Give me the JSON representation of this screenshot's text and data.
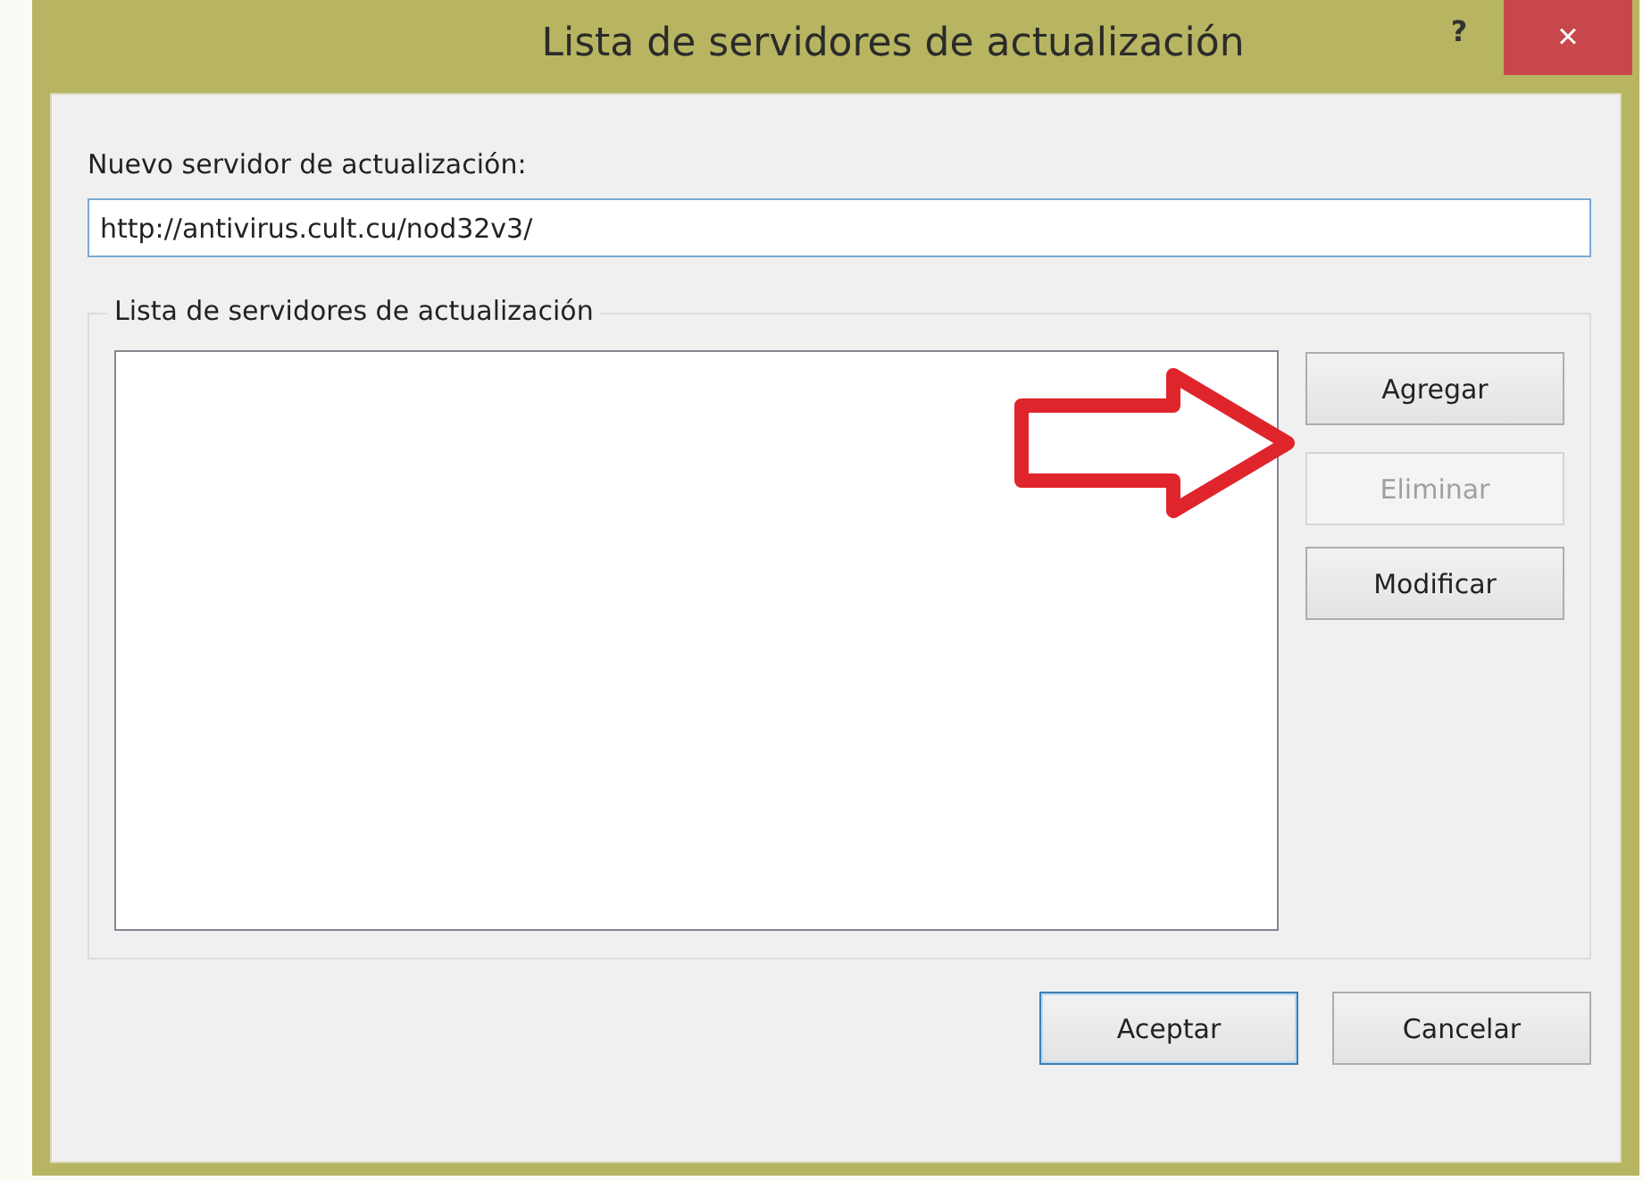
{
  "window": {
    "title": "Lista de servidores de actualización",
    "help": "?",
    "close": "×"
  },
  "new_server": {
    "label": "Nuevo servidor de actualización:",
    "value": "http://antivirus.cult.cu/nod32v3/"
  },
  "server_list": {
    "title": "Lista de servidores de actualización"
  },
  "side_buttons": [
    {
      "label": "Agregar",
      "disabled": false
    },
    {
      "label": "Eliminar",
      "disabled": true
    },
    {
      "label": "Modificar",
      "disabled": false
    }
  ],
  "buttons": [
    {
      "label": "Aceptar",
      "default": true
    },
    {
      "label": "Cancelar",
      "default": false
    }
  ]
}
